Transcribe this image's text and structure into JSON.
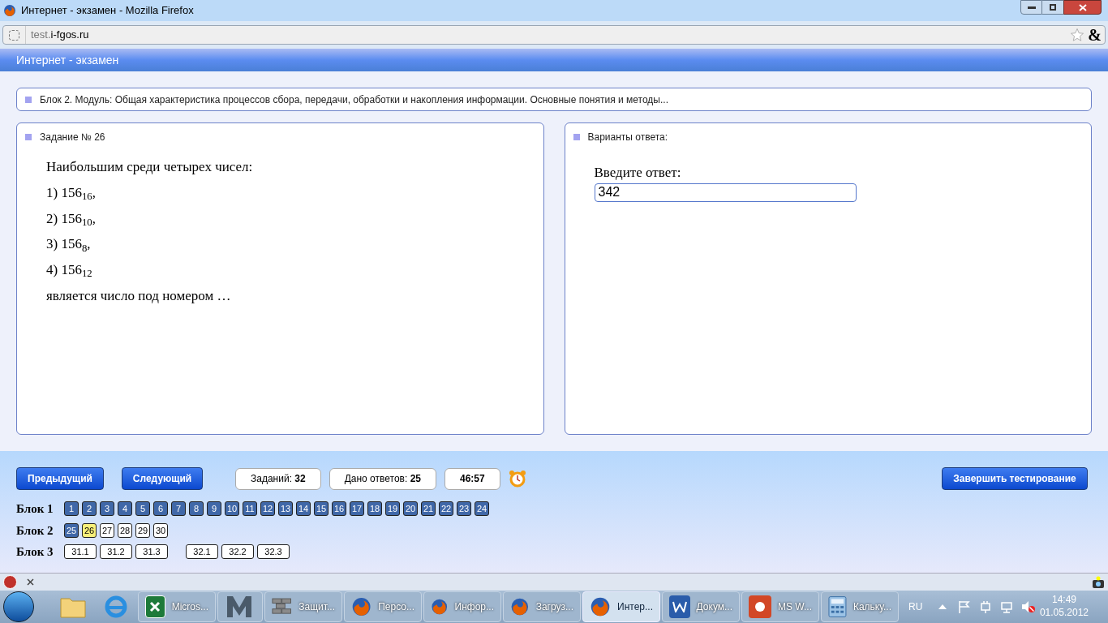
{
  "window": {
    "title": "Интернет - экзамен - Mozilla Firefox"
  },
  "address_bar": {
    "prefix": "test.",
    "domain": "i-fgos.ru",
    "amp": "&"
  },
  "site_header": "Интернет - экзамен",
  "block_title": "Блок 2. Модуль: Общая характеристика процессов сбора, передачи, обработки и накопления информации. Основные понятия и методы...",
  "task": {
    "title": "Задание № 26",
    "lines": [
      "Наибольшим среди четырех чисел:",
      "1) 156$_{16}$,",
      "2) 156$_{10}$,",
      "3) 156$_{8}$,",
      "4) 156$_{12}$",
      "является число под номером …"
    ]
  },
  "answer": {
    "title": "Варианты ответа:",
    "prompt": "Введите ответ:",
    "value": "342"
  },
  "buttons": {
    "prev": "Предыдущий",
    "next": "Следующий",
    "finish": "Завершить тестирование"
  },
  "stats": [
    {
      "label": "Заданий:",
      "value": "32"
    },
    {
      "label": "Дано ответов:",
      "value": "25"
    },
    {
      "value": "46:57"
    }
  ],
  "blocks": [
    {
      "label": "Блок 1",
      "groups": [
        [
          {
            "n": "1",
            "answered": true,
            "selected": false
          },
          {
            "n": "2",
            "answered": true,
            "selected": false
          },
          {
            "n": "3",
            "answered": true,
            "selected": false
          },
          {
            "n": "4",
            "answered": true,
            "selected": false
          },
          {
            "n": "5",
            "answered": true,
            "selected": false
          },
          {
            "n": "6",
            "answered": true,
            "selected": false
          },
          {
            "n": "7",
            "answered": true,
            "selected": false
          },
          {
            "n": "8",
            "answered": true,
            "selected": false
          },
          {
            "n": "9",
            "answered": true,
            "selected": false
          },
          {
            "n": "10",
            "answered": true,
            "selected": false
          },
          {
            "n": "11",
            "answered": true,
            "selected": false
          },
          {
            "n": "12",
            "answered": true,
            "selected": false
          },
          {
            "n": "13",
            "answered": true,
            "selected": false
          },
          {
            "n": "14",
            "answered": true,
            "selected": false
          },
          {
            "n": "15",
            "answered": true,
            "selected": false
          },
          {
            "n": "16",
            "answered": true,
            "selected": false
          },
          {
            "n": "17",
            "answered": true,
            "selected": false
          },
          {
            "n": "18",
            "answered": true,
            "selected": false
          },
          {
            "n": "19",
            "answered": true,
            "selected": false
          },
          {
            "n": "20",
            "answered": true,
            "selected": false
          },
          {
            "n": "21",
            "answered": true,
            "selected": false
          },
          {
            "n": "22",
            "answered": true,
            "selected": false
          },
          {
            "n": "23",
            "answered": true,
            "selected": false
          },
          {
            "n": "24",
            "answered": true,
            "selected": false
          }
        ]
      ]
    },
    {
      "label": "Блок 2",
      "groups": [
        [
          {
            "n": "25",
            "answered": true,
            "selected": false
          },
          {
            "n": "26",
            "answered": false,
            "selected": true
          },
          {
            "n": "27",
            "answered": false,
            "selected": false
          },
          {
            "n": "28",
            "answered": false,
            "selected": false
          },
          {
            "n": "29",
            "answered": false,
            "selected": false
          },
          {
            "n": "30",
            "answered": false,
            "selected": false
          }
        ]
      ]
    },
    {
      "label": "Блок 3",
      "groups": [
        [
          {
            "n": "31.1",
            "answered": false,
            "selected": false
          },
          {
            "n": "31.2",
            "answered": false,
            "selected": false
          },
          {
            "n": "31.3",
            "answered": false,
            "selected": false
          }
        ],
        [
          {
            "n": "32.1",
            "answered": false,
            "selected": false
          },
          {
            "n": "32.2",
            "answered": false,
            "selected": false
          },
          {
            "n": "32.3",
            "answered": false,
            "selected": false
          }
        ]
      ]
    }
  ],
  "taskbar": {
    "items": [
      {
        "kind": "excel",
        "label": "Micros...",
        "selected": false
      },
      {
        "kind": "m",
        "selected": false
      },
      {
        "kind": "wall",
        "label": "Защит...",
        "selected": false
      },
      {
        "kind": "firefox",
        "label": "Персо...",
        "selected": false
      },
      {
        "kind": "firefox",
        "label": "Инфор...",
        "selected": false
      },
      {
        "kind": "firefox",
        "label": "Загруз...",
        "selected": false
      },
      {
        "kind": "firefox",
        "label": "Интер...",
        "selected": true
      },
      {
        "kind": "word",
        "label": "Докум...",
        "selected": false
      },
      {
        "kind": "ppt",
        "label": "MS W...",
        "selected": false
      },
      {
        "kind": "calc",
        "label": "Кальку...",
        "selected": false
      }
    ],
    "lang": "RU",
    "time": "14:49",
    "date": "01.05.2012"
  }
}
